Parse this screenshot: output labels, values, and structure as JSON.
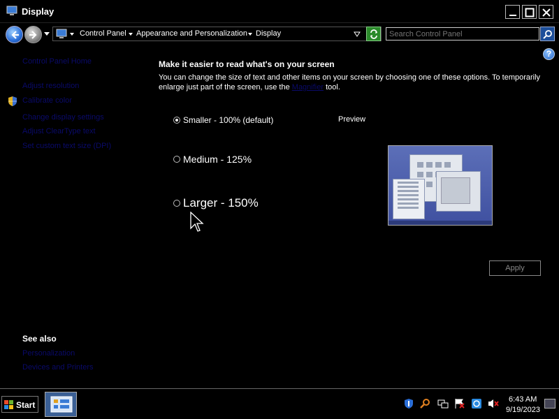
{
  "window": {
    "title": "Display",
    "app_icon": "display-icon",
    "controls": [
      "minimize-icon",
      "maximize-icon",
      "close-icon"
    ]
  },
  "address_bar": {
    "breadcrumbs": [
      "Control Panel",
      "Appearance and Personalization",
      "Display"
    ],
    "search_placeholder": "Search Control Panel"
  },
  "left_nav": {
    "links": [
      "Control Panel Home",
      "Adjust resolution",
      "Calibrate color",
      "Change display settings",
      "Adjust ClearType text",
      "Set custom text size (DPI)"
    ],
    "see_also_heading": "See also",
    "see_also_links": [
      "Personalization",
      "Devices and Printers"
    ]
  },
  "main": {
    "heading": "Make it easier to read what's on your screen",
    "description_before": "You can change the size of text and other items on your screen by choosing one of these options. To temporarily enlarge just part of the screen, use the ",
    "description_link": "Magnifier",
    "description_after": " tool.",
    "options": [
      {
        "label": "Smaller - 100% (default)",
        "selected": true
      },
      {
        "label": "Medium - 125%",
        "selected": false
      },
      {
        "label": "Larger - 150%",
        "selected": false
      }
    ],
    "preview_label": "Preview",
    "apply_label": "Apply",
    "apply_enabled": false
  },
  "taskbar": {
    "start_label": "Start",
    "tray_icons": [
      "defender-icon",
      "search-tool-icon",
      "network-icon",
      "action-center-flag-icon",
      "security-icon",
      "volume-muted-icon"
    ],
    "time": "6:43 AM",
    "date": "9/19/2023"
  },
  "colors": {
    "background": "#000000",
    "link_color": "#0a0a6a",
    "text": "#ffffff"
  }
}
